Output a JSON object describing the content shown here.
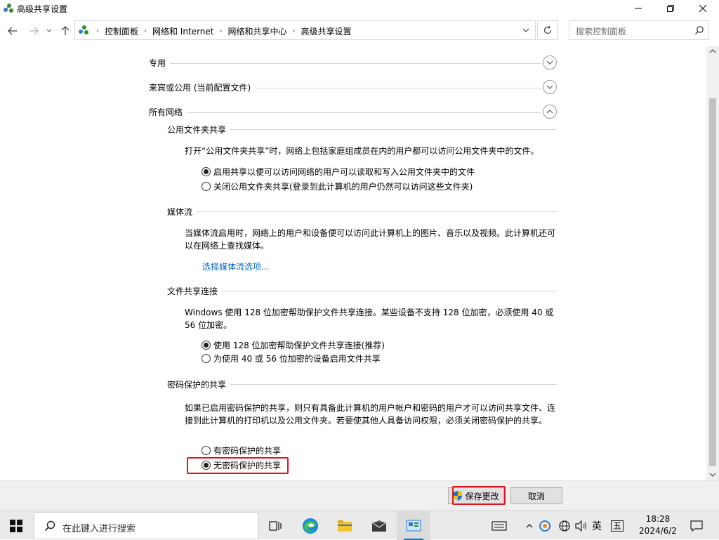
{
  "window": {
    "title": "高级共享设置"
  },
  "address_bar": {
    "breadcrumbs": [
      "控制面板",
      "网络和 Internet",
      "网络和共享中心",
      "高级共享设置"
    ],
    "search_placeholder": "搜索控制面板"
  },
  "sections": {
    "private": {
      "label": "专用"
    },
    "guest_public": {
      "label": "来宾或公用 (当前配置文件)"
    },
    "all_networks": {
      "label": "所有网络"
    }
  },
  "public_folder_sharing": {
    "heading": "公用文件夹共享",
    "description": "打开“公用文件夹共享”时，网络上包括家庭组成员在内的用户都可以访问公用文件夹中的文件。",
    "options": [
      {
        "label": "启用共享以便可以访问网络的用户可以读取和写入公用文件夹中的文件",
        "selected": true
      },
      {
        "label": "关闭公用文件夹共享(登录到此计算机的用户仍然可以访问这些文件夹)",
        "selected": false
      }
    ]
  },
  "media_streaming": {
    "heading": "媒体流",
    "description": "当媒体流启用时，网络上的用户和设备便可以访问此计算机上的图片、音乐以及视频。此计算机还可以在网络上查找媒体。",
    "link": "选择媒体流选项..."
  },
  "file_sharing_connections": {
    "heading": "文件共享连接",
    "description": "Windows 使用 128 位加密帮助保护文件共享连接。某些设备不支持 128 位加密，必须使用 40 或 56 位加密。",
    "options": [
      {
        "label": "使用 128 位加密帮助保护文件共享连接(推荐)",
        "selected": true
      },
      {
        "label": "为使用 40 或 56 位加密的设备启用文件共享",
        "selected": false
      }
    ]
  },
  "password_protected_sharing": {
    "heading": "密码保护的共享",
    "description": "如果已启用密码保护的共享，则只有具备此计算机的用户帐户和密码的用户才可以访问共享文件、连接到此计算机的打印机以及公用文件夹。若要使其他人具备访问权限，必须关闭密码保护的共享。",
    "options": [
      {
        "label": "有密码保护的共享",
        "selected": false
      },
      {
        "label": "无密码保护的共享",
        "selected": true
      }
    ]
  },
  "buttons": {
    "save": "保存更改",
    "cancel": "取消"
  },
  "taskbar": {
    "search_placeholder": "在此键入进行搜索",
    "ime_lang": "英",
    "ime_mode": "五",
    "time": "18:28",
    "date": "2024/6/2"
  },
  "colors": {
    "highlight": "#e0161d",
    "link": "#0066cc",
    "accent": "#0078d4"
  }
}
